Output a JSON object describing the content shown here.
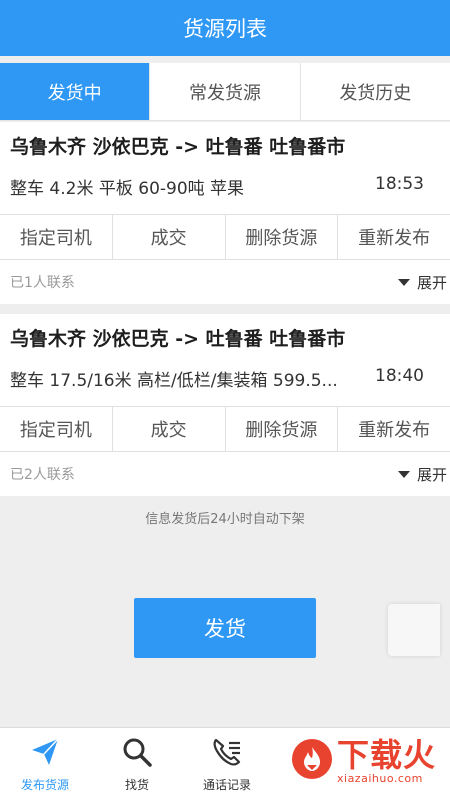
{
  "header": {
    "title": "货源列表"
  },
  "tabs": [
    {
      "label": "发货中",
      "active": true
    },
    {
      "label": "常发货源",
      "active": false
    },
    {
      "label": "发货历史",
      "active": false
    }
  ],
  "cards": [
    {
      "route": "乌鲁木齐 沙依巴克 -> 吐鲁番 吐鲁番市",
      "detail": "整车 4.2米 平板 60-90吨 苹果",
      "time": "18:53",
      "actions": [
        "指定司机",
        "成交",
        "删除货源",
        "重新发布"
      ],
      "contacts": "已1人联系",
      "expand": "展开"
    },
    {
      "route": "乌鲁木齐 沙依巴克 -> 吐鲁番 吐鲁番市",
      "detail": "整车 17.5/16米 高栏/低栏/集装箱 599.5...",
      "time": "18:40",
      "actions": [
        "指定司机",
        "成交",
        "删除货源",
        "重新发布"
      ],
      "contacts": "已2人联系",
      "expand": "展开"
    }
  ],
  "notice": "信息发货后24小时自动下架",
  "ship_button": "发货",
  "bottom_nav": [
    {
      "label": "发布货源",
      "icon": "send-icon",
      "active": true
    },
    {
      "label": "找货",
      "icon": "search-icon",
      "active": false
    },
    {
      "label": "通话记录",
      "icon": "phone-log-icon",
      "active": false
    }
  ],
  "watermark": {
    "text": "下载火",
    "sub": "xiazaihuo.com"
  },
  "colors": {
    "primary": "#2f98f4",
    "watermark": "#e8432f"
  }
}
